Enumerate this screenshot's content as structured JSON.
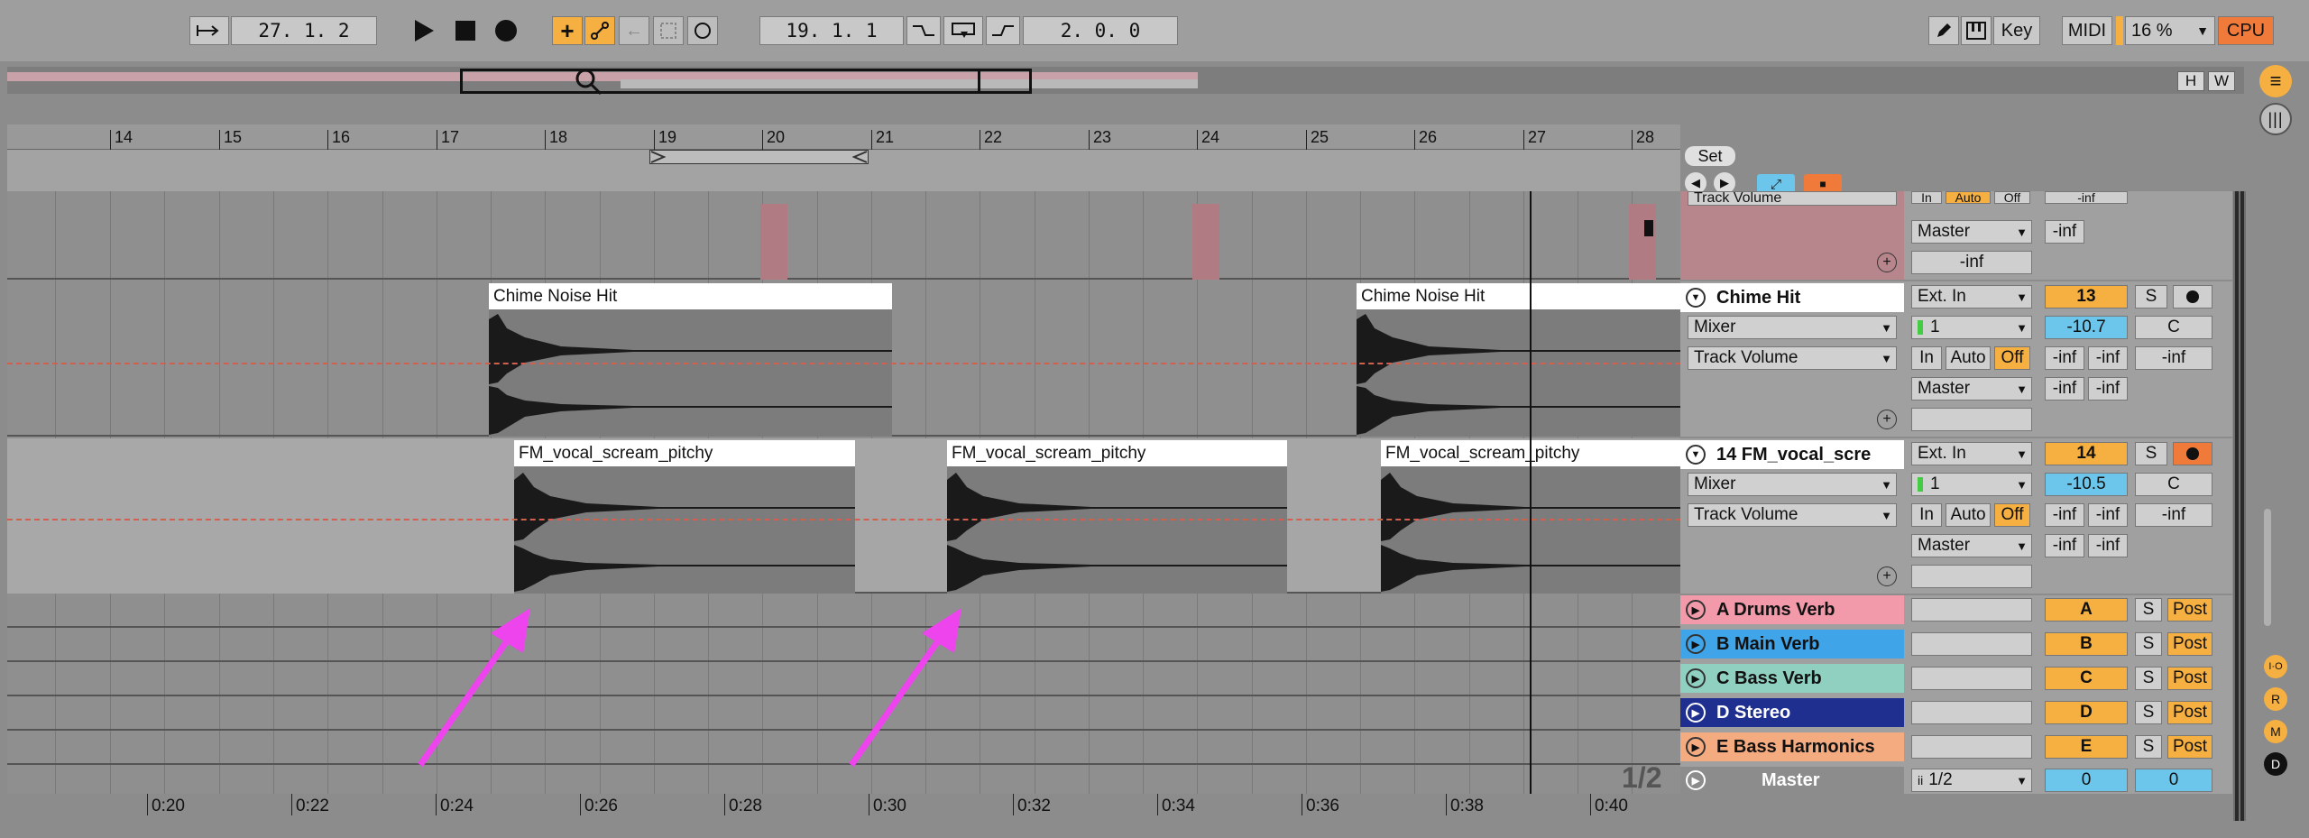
{
  "transport": {
    "arrangement_position": "27.  1.  2",
    "loop_start": "19.  1.  1",
    "loop_length": "2.  0.  0",
    "zoom": "16 %"
  },
  "toolbar_right": {
    "key_label": "Key",
    "midi_label": "MIDI",
    "cpu_label": "CPU"
  },
  "overview": {
    "h_label": "H",
    "w_label": "W"
  },
  "ruler": {
    "bars": [
      "14",
      "15",
      "16",
      "17",
      "18",
      "19",
      "20",
      "21",
      "22",
      "23",
      "24",
      "25",
      "26",
      "27",
      "28"
    ]
  },
  "set_label": "Set",
  "time_axis": [
    "0:20",
    "0:22",
    "0:24",
    "0:26",
    "0:28",
    "0:30",
    "0:32",
    "0:34",
    "0:36",
    "0:38",
    "0:40"
  ],
  "page_indicator": "1/2",
  "tracks": {
    "top": {
      "output": "Master",
      "vol": "-inf",
      "pan": "-inf",
      "partial_auto": "Track Volume",
      "partial_in": "In",
      "partial_autobtn": "Auto",
      "partial_off": "Off",
      "partial_inf": "-inf"
    },
    "chime": {
      "name": "Chime Hit",
      "clips": [
        "Chime Noise Hit",
        "Chime Noise Hit"
      ],
      "input": "Ext. In",
      "input_sub": "Mixer",
      "channel": "1",
      "auto": "Track Volume",
      "output": "Master",
      "number": "13",
      "solo": "S",
      "volume": "-10.7",
      "pan": "C",
      "in": "In",
      "autobtn": "Auto",
      "off": "Off",
      "inf": "-inf"
    },
    "fm": {
      "name": "14 FM_vocal_scre",
      "clips": [
        "FM_vocal_scream_pitchy",
        "FM_vocal_scream_pitchy",
        "FM_vocal_scream_pitchy"
      ],
      "input": "Ext. In",
      "input_sub": "Mixer",
      "channel": "1",
      "auto": "Track Volume",
      "output": "Master",
      "number": "14",
      "solo": "S",
      "volume": "-10.5",
      "pan": "C",
      "in": "In",
      "autobtn": "Auto",
      "off": "Off",
      "inf": "-inf"
    }
  },
  "returns": [
    {
      "name": "A Drums Verb",
      "letter": "A",
      "color": "#f29aa9"
    },
    {
      "name": "B Main Verb",
      "letter": "B",
      "color": "#3fa4e8"
    },
    {
      "name": "C Bass Verb",
      "letter": "C",
      "color": "#8fd0c0"
    },
    {
      "name": "D Stereo",
      "letter": "D",
      "color": "#1f2f8f"
    },
    {
      "name": "E Bass Harmonics",
      "letter": "E",
      "color": "#f5ab80"
    }
  ],
  "return_solo": "S",
  "return_post": "Post",
  "master": {
    "name": "Master",
    "cue": "1/2",
    "vol": "0",
    "pan": "0"
  },
  "side_buttons": [
    "I·O",
    "R",
    "M",
    "D"
  ]
}
